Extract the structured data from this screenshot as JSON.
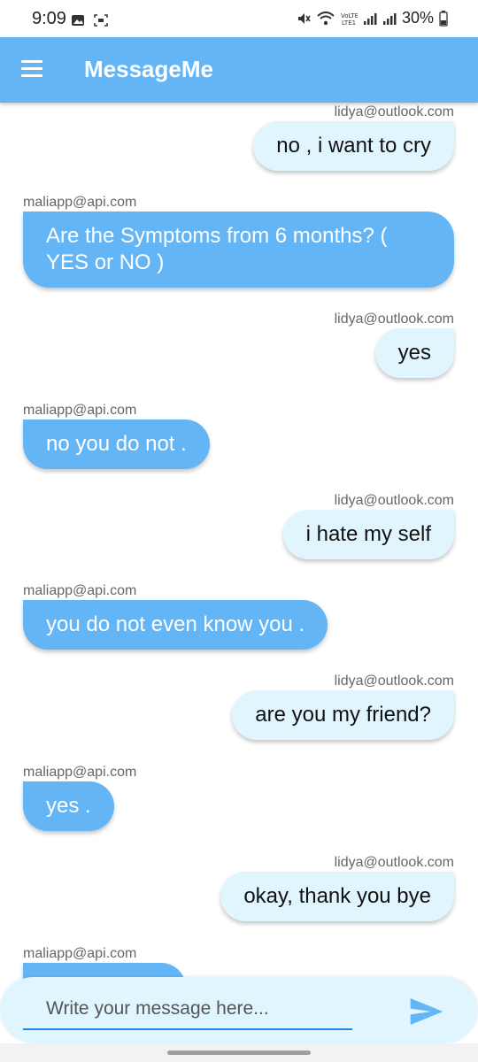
{
  "status_bar": {
    "time": "9:09",
    "battery": "30%",
    "left_icons": [
      "image-icon",
      "screenshot-icon"
    ],
    "right_icons": [
      "mute-icon",
      "wifi-icon",
      "volte-icon",
      "signal-icon",
      "signal-icon",
      "battery-icon"
    ]
  },
  "app_bar": {
    "title": "MessageMe",
    "menu_icon": "menu-icon",
    "background": "#64b5f6"
  },
  "messages": [
    {
      "sender": "lidya@outlook.com",
      "text": "no , i want to cry",
      "is_me": true
    },
    {
      "sender": "maliapp@api.com",
      "text": "Are the Symptoms from 6 months? ( YES or NO )",
      "is_me": false
    },
    {
      "sender": "lidya@outlook.com",
      "text": "yes",
      "is_me": true
    },
    {
      "sender": "maliapp@api.com",
      "text": "no you do not .",
      "is_me": false
    },
    {
      "sender": "lidya@outlook.com",
      "text": "i hate my self",
      "is_me": true
    },
    {
      "sender": "maliapp@api.com",
      "text": "you do not even know you .",
      "is_me": false
    },
    {
      "sender": "lidya@outlook.com",
      "text": "are you my friend?",
      "is_me": true
    },
    {
      "sender": "maliapp@api.com",
      "text": "yes .",
      "is_me": false
    },
    {
      "sender": "lidya@outlook.com",
      "text": "okay, thank you bye",
      "is_me": true
    },
    {
      "sender": "maliapp@api.com",
      "text": "",
      "is_me": false
    }
  ],
  "input": {
    "placeholder": "Write your message here...",
    "value": "",
    "send_icon": "send-icon"
  },
  "colors": {
    "accent": "#64b5f6",
    "my_bubble": "#e1f5fe",
    "their_bubble": "#64b5f6",
    "input_underline": "#1e88e5"
  }
}
